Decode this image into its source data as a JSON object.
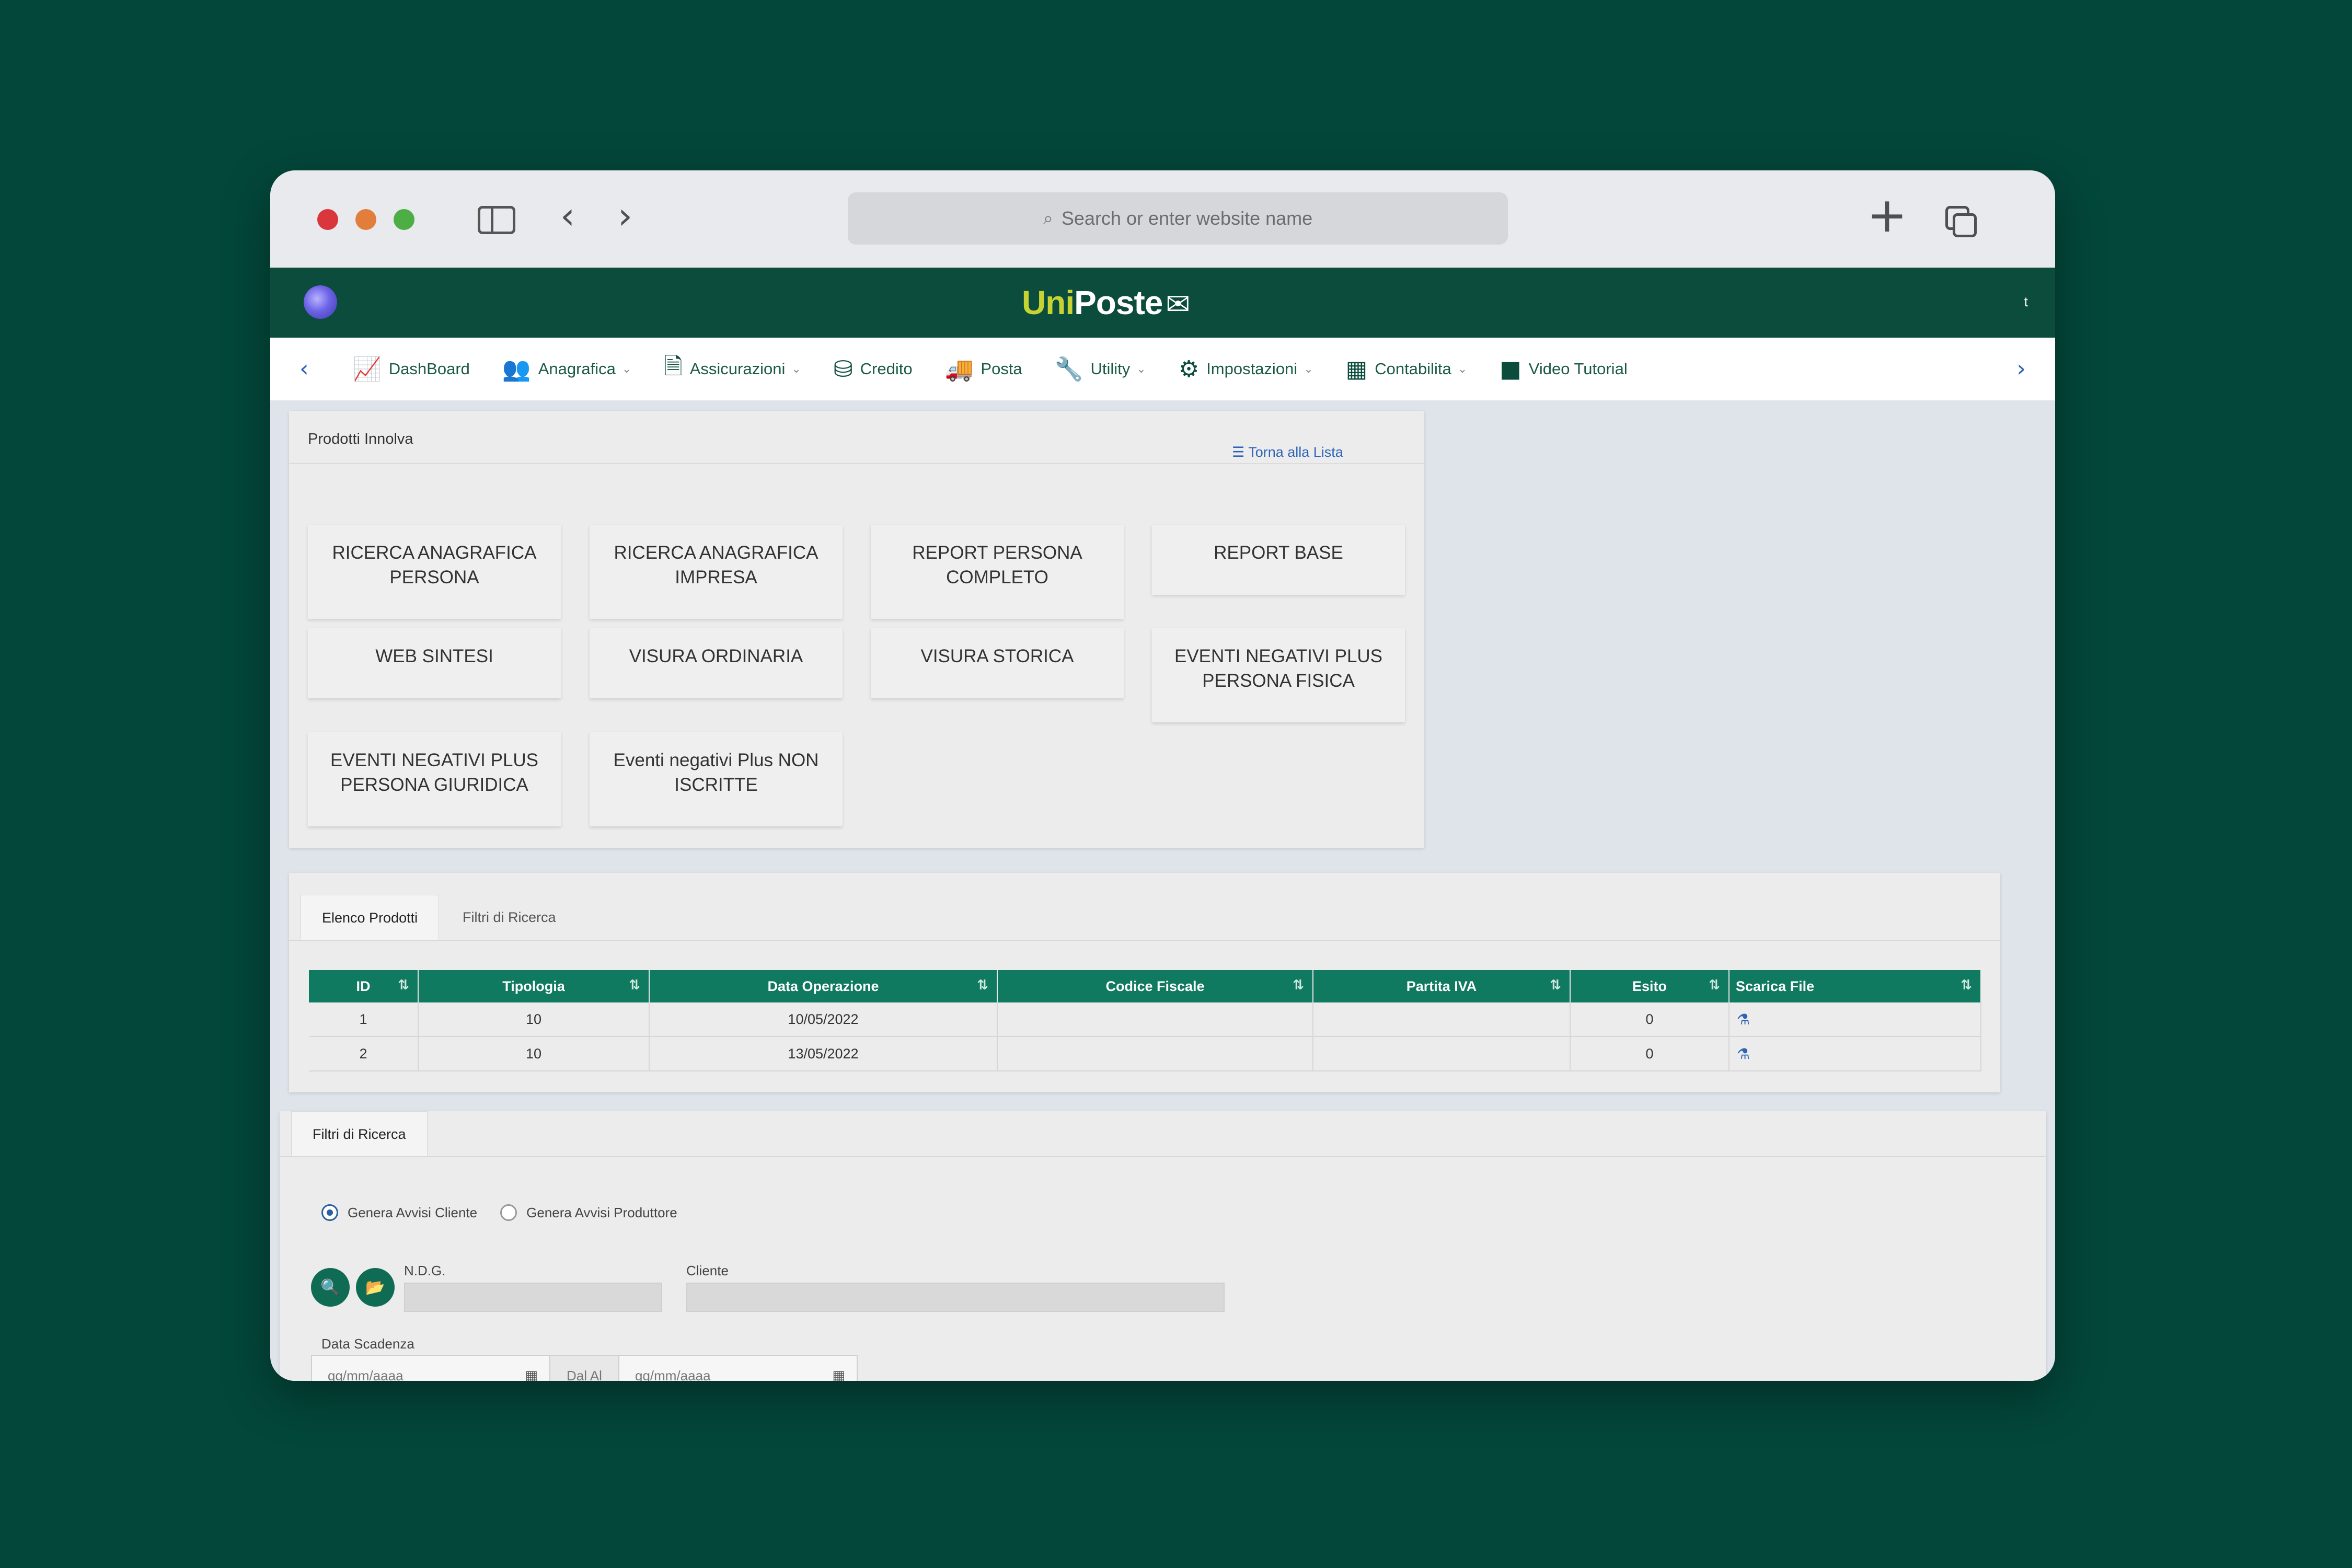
{
  "browser": {
    "address_placeholder": "Search or enter website name"
  },
  "app": {
    "brand_uni": "Uni",
    "brand_poste": "Poste",
    "user_initial": "t"
  },
  "nav": {
    "items": [
      {
        "label": "DashBoard",
        "icon": "chart-line-icon"
      },
      {
        "label": "Anagrafica",
        "icon": "users-icon"
      },
      {
        "label": "Assicurazioni",
        "icon": "document-icon"
      },
      {
        "label": "Credito",
        "icon": "coins-icon"
      },
      {
        "label": "Posta",
        "icon": "mail-truck-icon"
      },
      {
        "label": "Utility",
        "icon": "wrench-icon"
      },
      {
        "label": "Impostazioni",
        "icon": "gears-icon"
      },
      {
        "label": "Contabilita",
        "icon": "calculator-icon"
      },
      {
        "label": "Video Tutorial",
        "icon": "video-icon"
      }
    ]
  },
  "products": {
    "title": "Prodotti Innolva",
    "back_link": "Torna alla Lista",
    "buttons": [
      "RICERCA ANAGRAFICA PERSONA",
      "RICERCA ANAGRAFICA IMPRESA",
      "REPORT PERSONA COMPLETO",
      "REPORT BASE",
      "WEB SINTESI",
      "VISURA ORDINARIA",
      "VISURA STORICA",
      "EVENTI NEGATIVI PLUS PERSONA FISICA",
      "EVENTI NEGATIVI PLUS PERSONA GIURIDICA",
      "Eventi negativi Plus NON ISCRITTE"
    ]
  },
  "list": {
    "tabs": [
      "Elenco Prodotti",
      "Filtri di Ricerca"
    ],
    "columns": [
      "ID",
      "Tipologia",
      "Data Operazione",
      "Codice Fiscale",
      "Partita IVA",
      "Esito",
      "Scarica File"
    ],
    "rows": [
      {
        "id": "1",
        "tipologia": "10",
        "data": "10/05/2022",
        "cf": "",
        "piva": "",
        "esito": "0"
      },
      {
        "id": "2",
        "tipologia": "10",
        "data": "13/05/2022",
        "cf": "",
        "piva": "",
        "esito": "0"
      }
    ]
  },
  "filters": {
    "tab": "Filtri di Ricerca",
    "radio_cliente": "Genera Avvisi Cliente",
    "radio_produttore": "Genera Avvisi Produttore",
    "ndg_label": "N.D.G.",
    "cliente_label": "Cliente",
    "data_scadenza_label": "Data Scadenza",
    "date_placeholder": "gg/mm/aaaa",
    "dal_al": "Dal Al"
  },
  "colors": {
    "page_bg": "#03473a",
    "header_bg": "#0b4c3d",
    "table_header": "#0f7a5f",
    "brand_accent": "#c7d233",
    "link": "#2e63b6"
  }
}
